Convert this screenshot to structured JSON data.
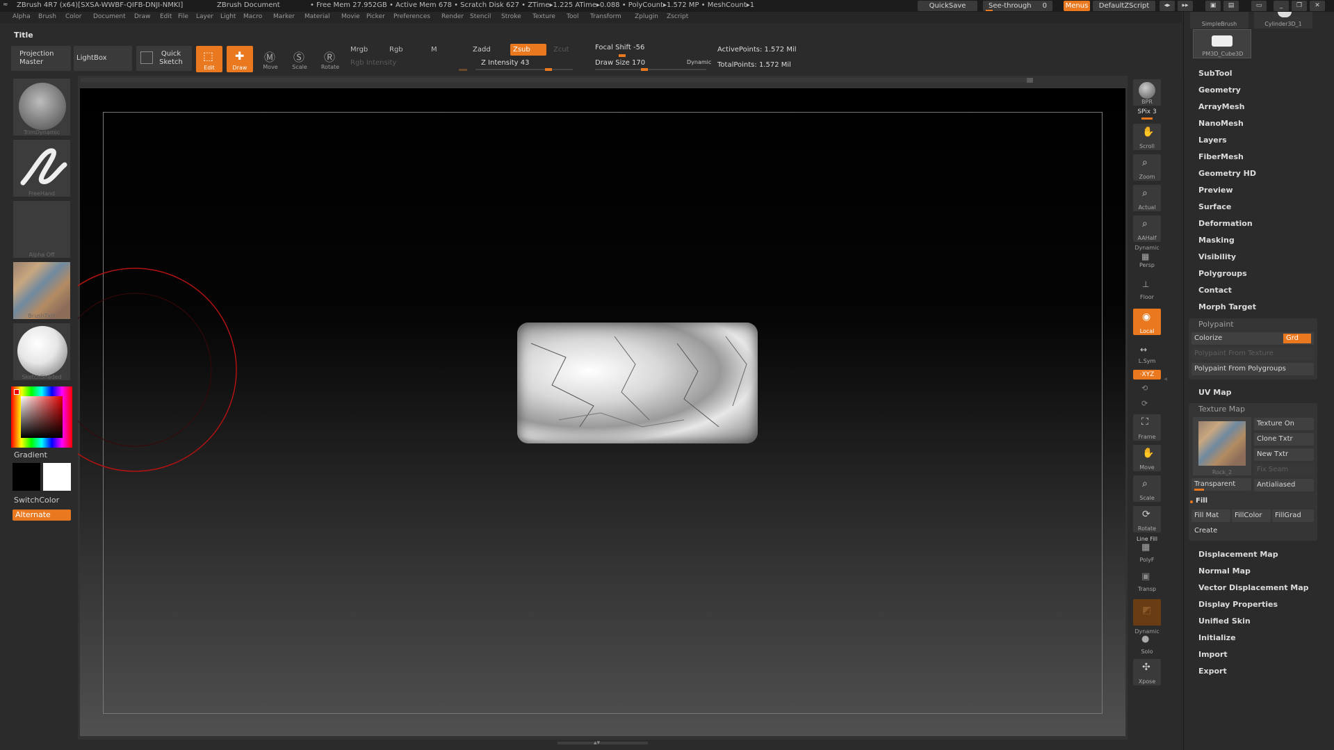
{
  "titlebar": {
    "app": "ZBrush 4R7 (x64)[SXSA-WWBF-QIFB-DNJI-NMKI]",
    "document": "ZBrush Document",
    "stats": "• Free Mem 27.952GB • Active Mem 678 • Scratch Disk 627 • ZTime▸1.225 ATime▸0.088 • PolyCount▸1.572 MP • MeshCount▸1",
    "quicksave": "QuickSave",
    "see_through": "See-through",
    "see_through_value": "0",
    "menus": "Menus",
    "default_zscript": "DefaultZScript"
  },
  "menubar": [
    "Alpha",
    "Brush",
    "Color",
    "Document",
    "Draw",
    "Edit",
    "File",
    "Layer",
    "Light",
    "Macro",
    "Marker",
    "Material",
    "Movie",
    "Picker",
    "Preferences",
    "Render",
    "Stencil",
    "Stroke",
    "Texture",
    "Tool",
    "Transform",
    "Zplugin",
    "Zscript"
  ],
  "header": {
    "title": "Title",
    "projection_master": "Projection Master",
    "lightbox": "LightBox",
    "quick_sketch": "Quick Sketch",
    "edit": "Edit",
    "draw": "Draw",
    "move": "Move",
    "scale": "Scale",
    "rotate": "Rotate",
    "mrgb": "Mrgb",
    "rgb": "Rgb",
    "m": "M",
    "rgb_intensity": "Rgb Intensity",
    "zadd": "Zadd",
    "zsub": "Zsub",
    "zcut": "Zcut",
    "z_intensity": "Z Intensity 43",
    "focal_shift": "Focal Shift -56",
    "draw_size": "Draw Size 170",
    "dynamic": "Dynamic",
    "active_points": "ActivePoints: 1.572 Mil",
    "total_points": "TotalPoints: 1.572 Mil"
  },
  "left_shelf": {
    "brush": "TrimDynamic",
    "stroke": "FreeHand",
    "alpha": "Alpha Off",
    "texture": "BrushTxtr",
    "material": "SketchShaded",
    "gradient": "Gradient",
    "switchcolor": "SwitchColor",
    "alternate": "Alternate"
  },
  "right_shelf": {
    "bpr": "BPR",
    "spix": "SPix 3",
    "scroll": "Scroll",
    "zoom": "Zoom",
    "actual": "Actual",
    "aahalf": "AAHalf",
    "dynamic_persp_top": "Dynamic",
    "persp": "Persp",
    "floor": "Floor",
    "local": "Local",
    "lsym": "L.Sym",
    "xyz": "·XYZ",
    "frame": "Frame",
    "move": "Move",
    "scale": "Scale",
    "rotate": "Rotate",
    "line_fill": "Line Fill",
    "polyf": "PolyF",
    "transp": "Transp",
    "dynamic_solo": "Dynamic",
    "solo": "Solo",
    "xpose": "Xpose"
  },
  "palette": {
    "tools": [
      "SimpleBrush",
      "Cylinder3D_1",
      "PM3D_Cube3D"
    ],
    "items_top": [
      "SubTool",
      "Geometry",
      "ArrayMesh",
      "NanoMesh",
      "Layers",
      "FiberMesh",
      "Geometry HD",
      "Preview",
      "Surface",
      "Deformation",
      "Masking",
      "Visibility",
      "Polygroups",
      "Contact",
      "Morph Target"
    ],
    "polypaint": {
      "title": "Polypaint",
      "colorize": "Colorize",
      "grd": "Grd",
      "from_texture": "Polypaint From Texture",
      "from_polygroups": "Polypaint From Polygroups"
    },
    "uv_map": "UV Map",
    "texture_map": {
      "title": "Texture Map",
      "texture_name": "Rock_2",
      "texture_on": "Texture On",
      "clone_txtr": "Clone Txtr",
      "new_txtr": "New Txtr",
      "fix_seam": "Fix Seam",
      "transparent": "Transparent",
      "antialiased": "Antialiased",
      "fill": "Fill",
      "fill_mat": "Fill Mat",
      "fill_color": "FillColor",
      "fill_grad": "FillGrad",
      "create": "Create"
    },
    "items_bottom": [
      "Displacement Map",
      "Normal Map",
      "Vector Displacement Map",
      "Display Properties",
      "Unified Skin",
      "Initialize",
      "Import",
      "Export"
    ]
  },
  "colors": {
    "accent": "#e9781e",
    "panel": "#2b2b2b",
    "canvas_top": "#000000",
    "canvas_bottom": "#505050"
  }
}
